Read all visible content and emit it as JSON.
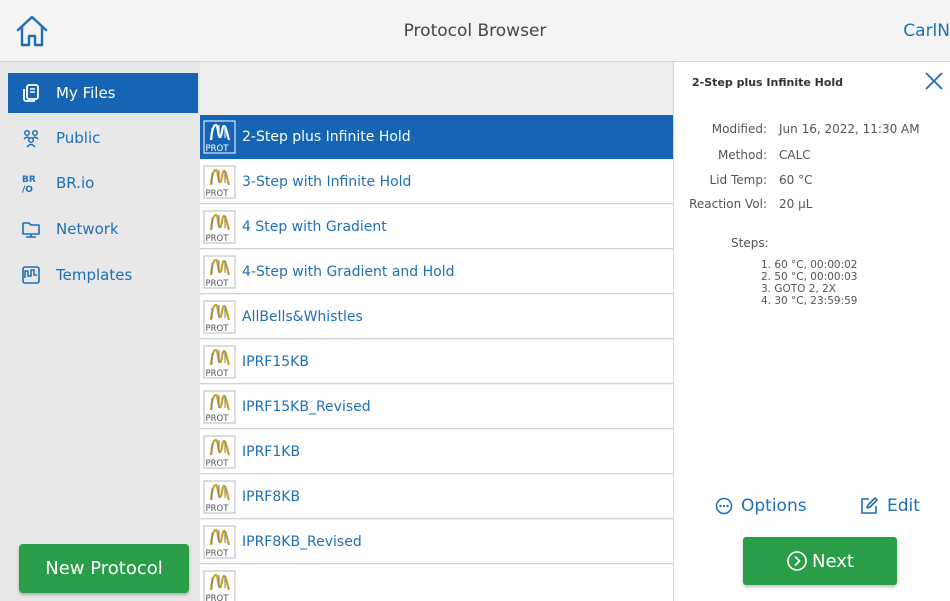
{
  "header": {
    "title": "Protocol Browser",
    "user": "CarlN",
    "home_icon": "home-icon"
  },
  "sidebar": {
    "items": [
      {
        "label": "My Files",
        "icon": "files-icon",
        "active": true
      },
      {
        "label": "Public",
        "icon": "people-icon",
        "active": false
      },
      {
        "label": "BR.io",
        "icon": "brio-logo-icon",
        "active": false
      },
      {
        "label": "Network",
        "icon": "network-folder-icon",
        "active": false
      },
      {
        "label": "Templates",
        "icon": "template-icon",
        "active": false
      }
    ],
    "new_protocol_label": "New Protocol"
  },
  "files": {
    "icon_text": "PROT",
    "items": [
      {
        "name": "2-Step plus Infinite Hold",
        "selected": true
      },
      {
        "name": "3-Step with Infinite Hold",
        "selected": false
      },
      {
        "name": "4 Step with Gradient",
        "selected": false
      },
      {
        "name": "4-Step with Gradient and Hold",
        "selected": false
      },
      {
        "name": "AllBells&Whistles",
        "selected": false
      },
      {
        "name": "IPRF15KB",
        "selected": false
      },
      {
        "name": "IPRF15KB_Revised",
        "selected": false
      },
      {
        "name": "IPRF1KB",
        "selected": false
      },
      {
        "name": "IPRF8KB",
        "selected": false
      },
      {
        "name": "IPRF8KB_Revised",
        "selected": false
      },
      {
        "name": "",
        "selected": false
      }
    ]
  },
  "details": {
    "title": "2-Step plus Infinite Hold",
    "fields": [
      {
        "label": "Modified:",
        "value": "Jun 16, 2022, 11:30 AM"
      },
      {
        "label": "Method:",
        "value": "CALC"
      },
      {
        "label": "Lid Temp:",
        "value": "60 °C"
      },
      {
        "label": "Reaction Vol:",
        "value": "20 µL"
      }
    ],
    "steps_label": "Steps:",
    "steps": [
      "1. 60 °C, 00:00:02",
      "2. 50 °C, 00:00:03",
      "3. GOTO 2, 2X",
      "4. 30 °C, 23:59:59"
    ],
    "options_label": "Options",
    "edit_label": "Edit",
    "next_label": "Next"
  },
  "colors": {
    "accent_blue": "#1565b4",
    "link_blue": "#1f6fb7",
    "green": "#2a9d49",
    "prot_icon_gold": "#c9a227"
  }
}
